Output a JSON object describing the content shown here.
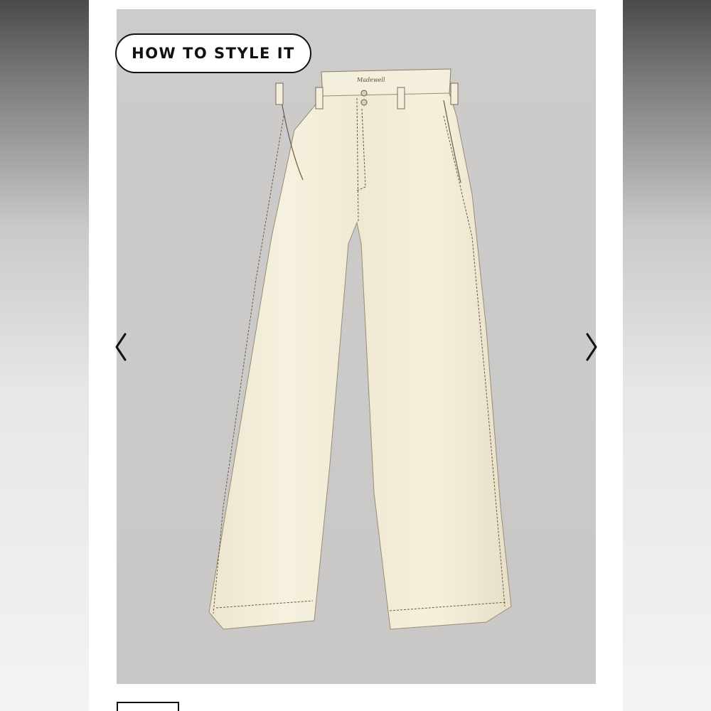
{
  "product_image": {
    "alt_label": "",
    "background_color": "#cbcac8",
    "garment_color": "#f3eedb",
    "stitch_color": "#6b5a48"
  },
  "badge": {
    "label": "HOW TO STYLE IT"
  },
  "carousel": {
    "prev_icon": "chevron-left-icon",
    "next_icon": "chevron-right-icon"
  },
  "thumbnails": {
    "count_visible": 1
  }
}
